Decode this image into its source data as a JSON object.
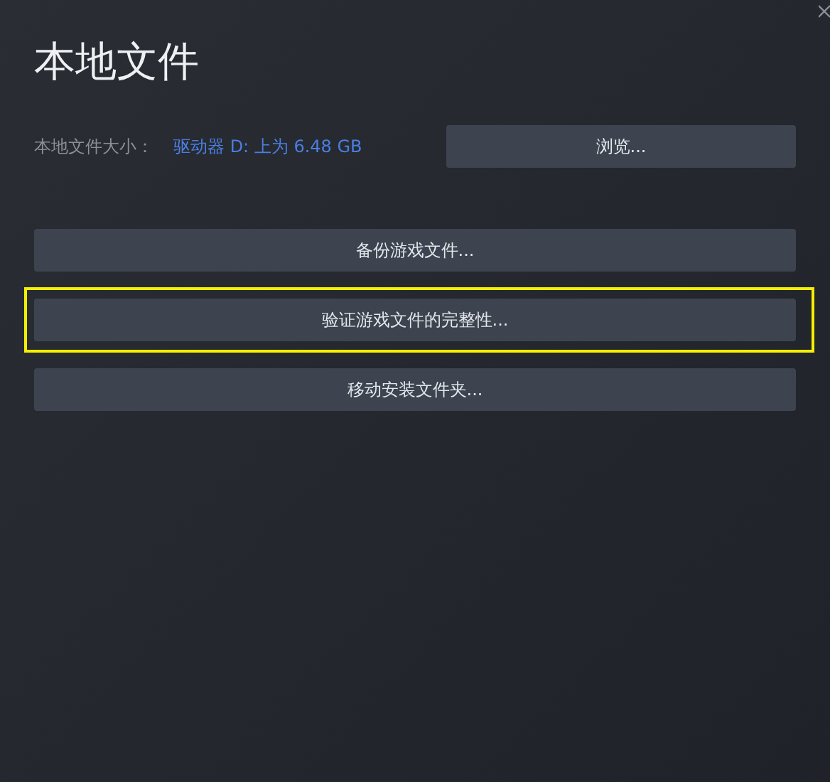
{
  "window": {
    "title": "本地文件"
  },
  "size": {
    "label": "本地文件大小：",
    "value": "驱动器 D: 上为 6.48 GB",
    "button": "浏览..."
  },
  "actions": [
    {
      "label": "备份游戏文件...",
      "highlighted": false
    },
    {
      "label": "验证游戏文件的完整性...",
      "highlighted": true
    },
    {
      "label": "移动安装文件夹...",
      "highlighted": false
    }
  ]
}
